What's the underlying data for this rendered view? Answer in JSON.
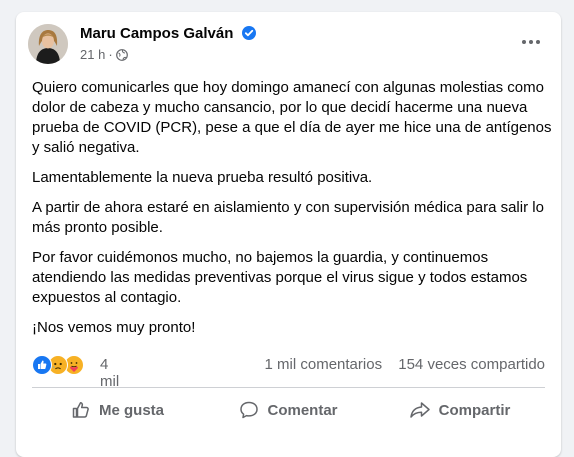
{
  "post": {
    "author": "Maru Campos Galván",
    "time": "21 h",
    "paragraphs": [
      "Quiero comunicarles que hoy domingo amanecí con algunas molestias como dolor de cabeza y mucho cansancio, por lo que decidí hacerme una nueva prueba de COVID (PCR), pese a que el día de ayer me hice una de antígenos y salió negativa.",
      "Lamentablemente la nueva prueba resultó positiva.",
      "A partir de ahora estaré en aislamiento y con supervisión médica para salir lo más pronto posible.",
      "Por favor cuidémonos mucho,  no bajemos la guardia, y continuemos atendiendo las medidas preventivas porque el virus sigue y todos estamos expuestos al contagio.",
      "¡Nos vemos muy pronto!"
    ]
  },
  "stats": {
    "reactions_count": "4 mil",
    "comments": "1 mil comentarios",
    "shares": "154 veces compartido",
    "reaction_icons": [
      "like-icon",
      "sad-icon",
      "care-icon"
    ]
  },
  "actions": {
    "like": "Me gusta",
    "comment": "Comentar",
    "share": "Compartir"
  },
  "colors": {
    "verified": "#1877f2",
    "like": "#1877f2",
    "sad": "#f7b125",
    "care": "#f7b125",
    "text": "#050505",
    "secondary": "#65676b"
  }
}
